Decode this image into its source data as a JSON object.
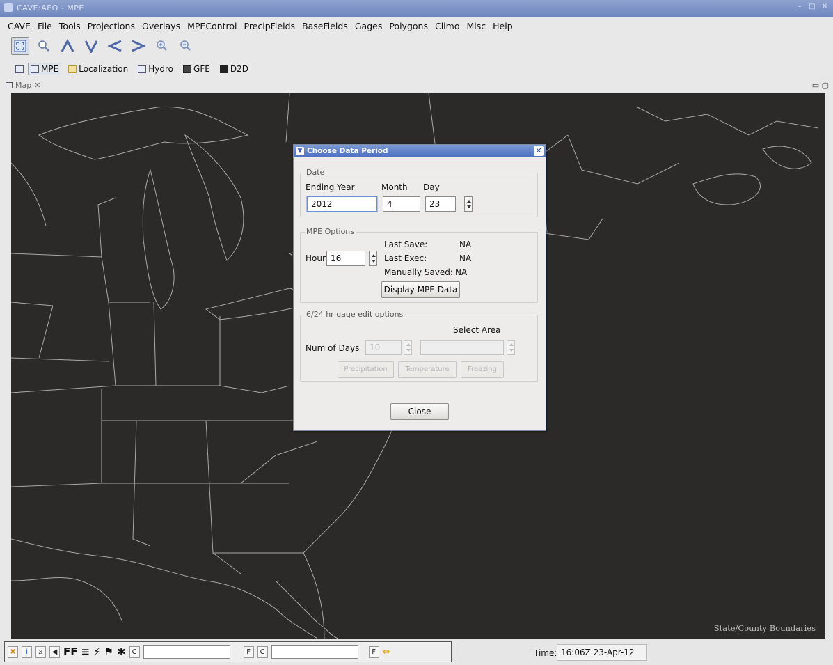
{
  "window": {
    "title": "CAVE:AEQ - MPE"
  },
  "menubar": [
    {
      "label": "CAVE"
    },
    {
      "label": "File"
    },
    {
      "label": "Tools"
    },
    {
      "label": "Projections"
    },
    {
      "label": "Overlays"
    },
    {
      "label": "MPEControl"
    },
    {
      "label": "PrecipFields"
    },
    {
      "label": "BaseFields"
    },
    {
      "label": "Gages"
    },
    {
      "label": "Polygons"
    },
    {
      "label": "Climo"
    },
    {
      "label": "Misc"
    },
    {
      "label": "Help"
    }
  ],
  "toolbar_icons": [
    "pan-icon",
    "zoom-icon",
    "up-arrow-icon",
    "down-arrow-icon",
    "left-arrow-icon",
    "right-arrow-icon",
    "zoom-in-icon",
    "zoom-out-icon"
  ],
  "perspectives": [
    {
      "label": "MPE",
      "active": true
    },
    {
      "label": "Localization",
      "active": false
    },
    {
      "label": "Hydro",
      "active": false
    },
    {
      "label": "GFE",
      "active": false
    },
    {
      "label": "D2D",
      "active": false
    }
  ],
  "map_tab": {
    "label": "Map"
  },
  "map": {
    "overlay_label": "State/County Boundaries"
  },
  "dialog": {
    "title": "Choose Data Period",
    "date_group": {
      "legend": "Date",
      "year_label": "Ending Year",
      "month_label": "Month",
      "day_label": "Day",
      "year": "2012",
      "month": "4",
      "day": "23"
    },
    "mpe_group": {
      "legend": "MPE Options",
      "hour_label": "Hour",
      "hour": "16",
      "last_save_label": "Last Save:",
      "last_save": "NA",
      "last_exec_label": "Last Exec:",
      "last_exec": "NA",
      "manual_label": "Manually Saved:",
      "manual": "NA",
      "display_button": "Display MPE Data"
    },
    "gage_group": {
      "legend": "6/24 hr gage edit options",
      "select_area_label": "Select Area",
      "num_days_label": "Num of Days",
      "num_days": "10",
      "precip_button": "Precipitation",
      "temp_button": "Temperature",
      "freezing_button": "Freezing"
    },
    "close_button": "Close"
  },
  "statusbar": {
    "time_label": "Time:",
    "time": "16:06Z 23-Apr-12",
    "ff_label": "FF",
    "c1": "C",
    "c2": "C",
    "f1": "F",
    "f2": "F"
  }
}
